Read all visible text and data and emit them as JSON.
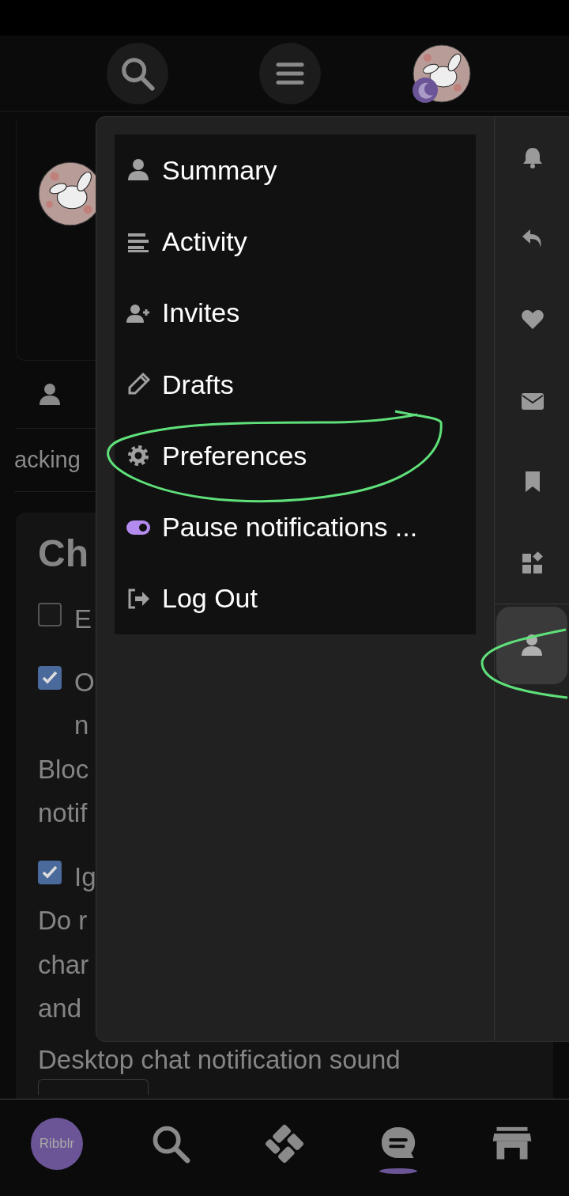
{
  "background": {
    "tab_label": "acking",
    "card_title": "Ch",
    "sound_label": "Desktop chat notification sound",
    "options": [
      {
        "lines": [
          "E"
        ],
        "checked": false
      },
      {
        "lines": [
          "O",
          "n"
        ],
        "checked": true,
        "description": [
          "Bloc",
          "notif"
        ]
      },
      {
        "lines": [
          "Ig"
        ],
        "checked": true,
        "description": [
          "Do r",
          "char",
          "and"
        ]
      }
    ]
  },
  "menu": {
    "items": [
      {
        "kind": "user",
        "label": "Summary"
      },
      {
        "kind": "activity",
        "label": "Activity"
      },
      {
        "kind": "invite",
        "label": "Invites"
      },
      {
        "kind": "pencil",
        "label": "Drafts"
      },
      {
        "kind": "gear",
        "label": "Preferences"
      },
      {
        "kind": "toggle",
        "label": "Pause notifications ...",
        "on": true
      },
      {
        "kind": "logout",
        "label": "Log Out"
      }
    ],
    "tabs": [
      {
        "kind": "bell",
        "selected": false
      },
      {
        "kind": "reply",
        "selected": false
      },
      {
        "kind": "heart",
        "selected": false
      },
      {
        "kind": "envelope",
        "selected": false
      },
      {
        "kind": "bookmark",
        "selected": false
      },
      {
        "kind": "widgets",
        "selected": false
      },
      {
        "kind": "user",
        "selected": true
      }
    ]
  },
  "bottom_nav": [
    {
      "kind": "logo",
      "label": "Ribblr",
      "selected": false
    },
    {
      "kind": "search",
      "selected": false
    },
    {
      "kind": "pattern",
      "selected": false
    },
    {
      "kind": "chat",
      "selected": true
    },
    {
      "kind": "shop",
      "selected": false
    }
  ]
}
